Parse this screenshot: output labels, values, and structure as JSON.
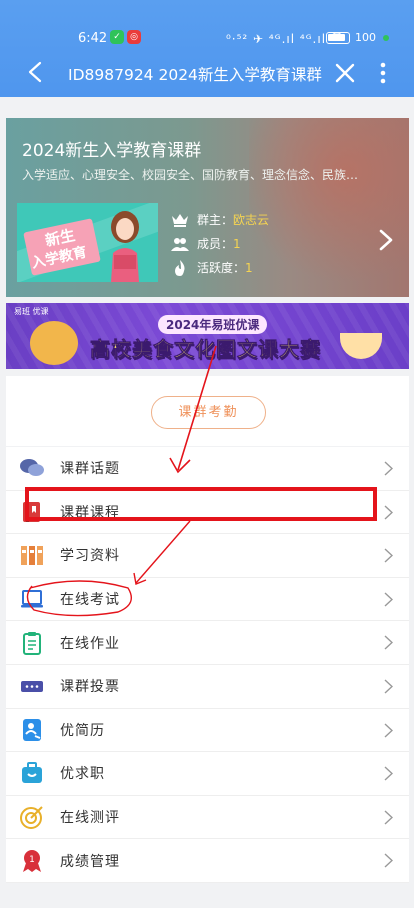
{
  "status": {
    "time": "6:42",
    "right": "⁰·⁵² ✈ ⁴ᴳ.ıl ⁴ᴳ.ıl ⌒",
    "battery": "100"
  },
  "nav": {
    "title": "ID8987924 2024新生入学教育课群"
  },
  "group": {
    "name": "2024新生入学教育课群",
    "description": "入学适应、心理安全、校园安全、国防教育、理念信念、民族…",
    "thumb_line1": "新生",
    "thumb_line2": "入学教育",
    "owner_label": "群主：",
    "owner": "欧志云",
    "members_label": "成员：",
    "members": "1",
    "activity_label": "活跃度：",
    "activity": "1"
  },
  "banner": {
    "logo": "易班 优课",
    "year": "2024年易班优课",
    "title": "高校美食文化图文课大赛"
  },
  "attendance": {
    "label": "课群考勤"
  },
  "menu": [
    {
      "label": "课群话题",
      "icon": "chat-bubbles-icon"
    },
    {
      "label": "课群课程",
      "icon": "book-icon"
    },
    {
      "label": "学习资料",
      "icon": "binders-icon"
    },
    {
      "label": "在线考试",
      "icon": "laptop-icon"
    },
    {
      "label": "在线作业",
      "icon": "clipboard-icon"
    },
    {
      "label": "课群投票",
      "icon": "ticket-icon"
    },
    {
      "label": "优简历",
      "icon": "resume-icon"
    },
    {
      "label": "优求职",
      "icon": "briefcase-icon"
    },
    {
      "label": "在线测评",
      "icon": "target-icon"
    },
    {
      "label": "成绩管理",
      "icon": "medal-icon"
    }
  ],
  "colors": {
    "header_blue": "#4f96ee",
    "accent_orange": "#ef915a",
    "annotation_red": "#e4141b"
  }
}
